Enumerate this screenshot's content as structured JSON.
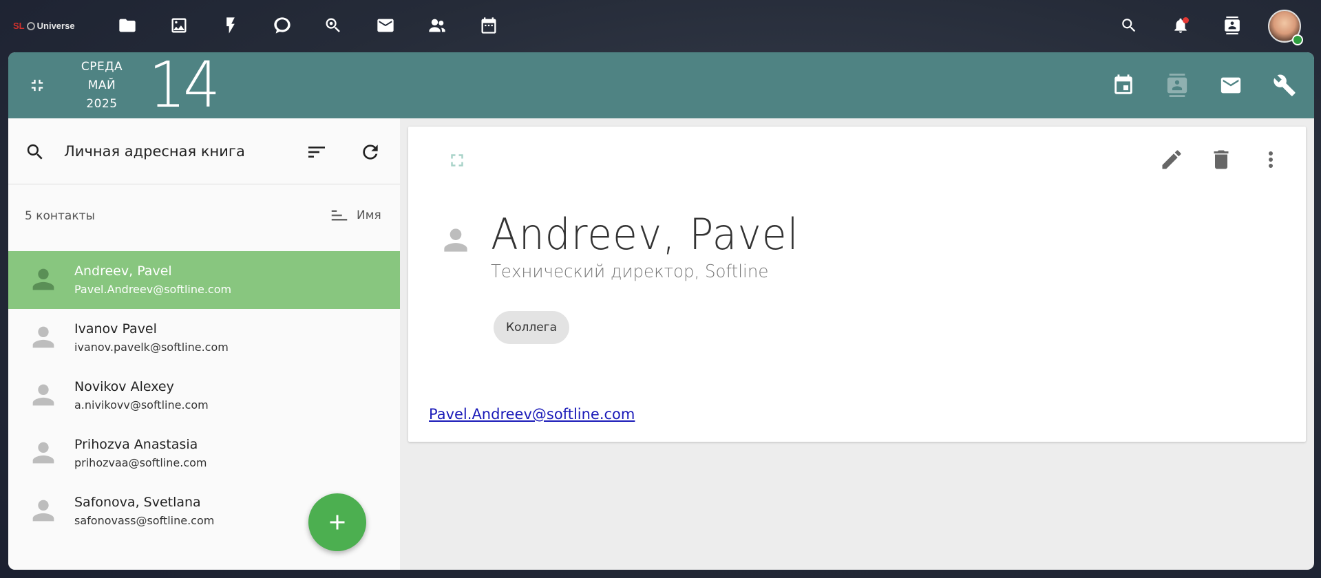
{
  "brand": {
    "prefix": "SL",
    "name": "Universe"
  },
  "nav": {
    "icons": [
      "folder-icon",
      "image-icon",
      "bolt-icon",
      "chat-icon",
      "key-search-icon",
      "mail-icon",
      "users-icon",
      "calendar-icon"
    ],
    "right_icons": [
      "search-icon",
      "bell-icon",
      "contact-card-icon"
    ]
  },
  "header": {
    "weekday": "СРЕДА",
    "month": "МАЙ",
    "year": "2025",
    "day": "14"
  },
  "sidebar": {
    "book_title": "Личная адресная книга",
    "count_label": "5 контакты",
    "sort_label": "Имя",
    "contacts": [
      {
        "name": "Andreev, Pavel",
        "email": "Pavel.Andreev@softline.com",
        "selected": true
      },
      {
        "name": "Ivanov Pavel",
        "email": "ivanov.pavelk@softline.com",
        "selected": false
      },
      {
        "name": "Novikov Alexey",
        "email": "a.nivikovv@softline.com",
        "selected": false
      },
      {
        "name": "Prihozva Anastasia",
        "email": "prihozvaa@softline.com",
        "selected": false
      },
      {
        "name": "Safonova, Svetlana",
        "email": "safonovass@softline.com",
        "selected": false
      }
    ]
  },
  "detail": {
    "name": "Andreev, Pavel",
    "title": "Технический директор, Softline",
    "tag": "Коллега",
    "email": "Pavel.Andreev@softline.com"
  },
  "colors": {
    "header_bg": "#4f8383",
    "selected_row": "#88c67f",
    "fab": "#4caf50",
    "link": "#1a1ab8"
  }
}
